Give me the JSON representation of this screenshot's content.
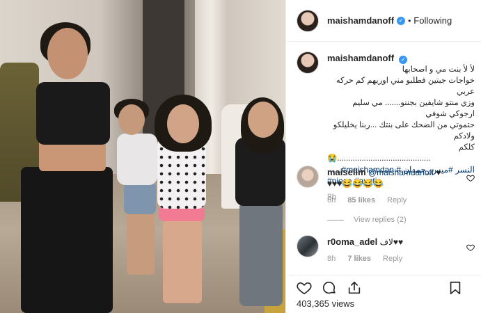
{
  "header": {
    "username": "maishamdanoff",
    "verified_glyph": "✓",
    "separator": "•",
    "follow_status": "Following"
  },
  "caption": {
    "username": "maishamdanoff",
    "lines": [
      "لأ لأ بنت مي و اصحابها",
      "خواجات جبتين فطلبو مني اوريهم كم حركه عربي",
      "وزي منتو شايفين بجننو....... مي سليم ارجوكي شوفي",
      "حتموتي من الضحك على بنتك ...ربنا يخليلكو ولادكم",
      "كلكم",
      "😭..........................................",
      "النسر #ميس_حمدان # maishamdan#......"
    ],
    "tags": "#niece #auntie",
    "time": "8h"
  },
  "comments": [
    {
      "username": "maiselim",
      "mention": "@maishamdanoff",
      "text": " ♥",
      "text2": "♥♥♥😂😂😂😂",
      "time": "6h",
      "likes": "85 likes",
      "reply": "Reply",
      "view_replies": "View replies (2)"
    },
    {
      "username": "r0oma_adel",
      "text": " لاف♥♥",
      "time": "8h",
      "likes": "7 likes",
      "reply": "Reply"
    }
  ],
  "actions": {
    "views": "403,365 views"
  },
  "icons": [
    "heart-icon",
    "comment-icon",
    "share-icon",
    "bookmark-icon",
    "verified-badge-icon"
  ],
  "colors": {
    "verified": "#3897f0",
    "link": "#003569",
    "muted": "#999999",
    "text": "#262626",
    "border": "#efefef"
  }
}
